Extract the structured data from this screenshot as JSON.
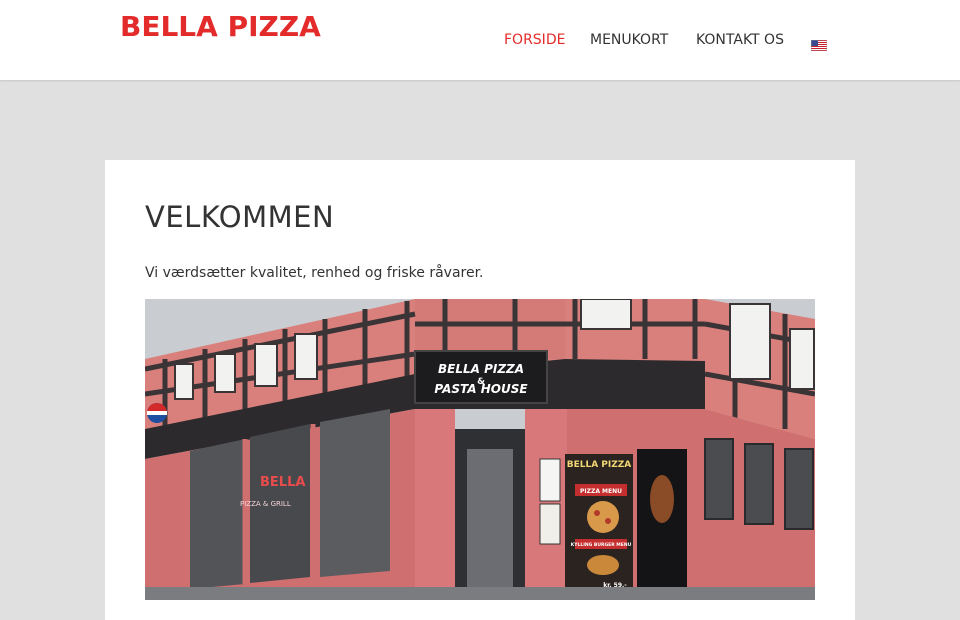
{
  "site": {
    "logo": "BELLA PIZZA",
    "brand_color": "#e32b2b"
  },
  "nav": {
    "items": [
      {
        "label": "FORSIDE",
        "active": true
      },
      {
        "label": "MENUKORT",
        "active": false
      },
      {
        "label": "KONTAKT OS",
        "active": false
      }
    ],
    "language_icon": "us-flag-icon"
  },
  "main": {
    "title": "VELKOMMEN",
    "intro": "Vi værdsætter kvalitet, renhed og friske råvarer.",
    "photo": {
      "sign_line1": "BELLA PIZZA",
      "sign_amp": "&",
      "sign_line2": "PASTA HOUSE",
      "window_bella": "BELLA",
      "window_grill": "PIZZA & GRILL",
      "poster_title": "BELLA PIZZA",
      "poster_menu": "PIZZA MENU",
      "poster_burger": "KYLLING BURGER MENU",
      "poster_price": "kr. 59,-"
    }
  }
}
